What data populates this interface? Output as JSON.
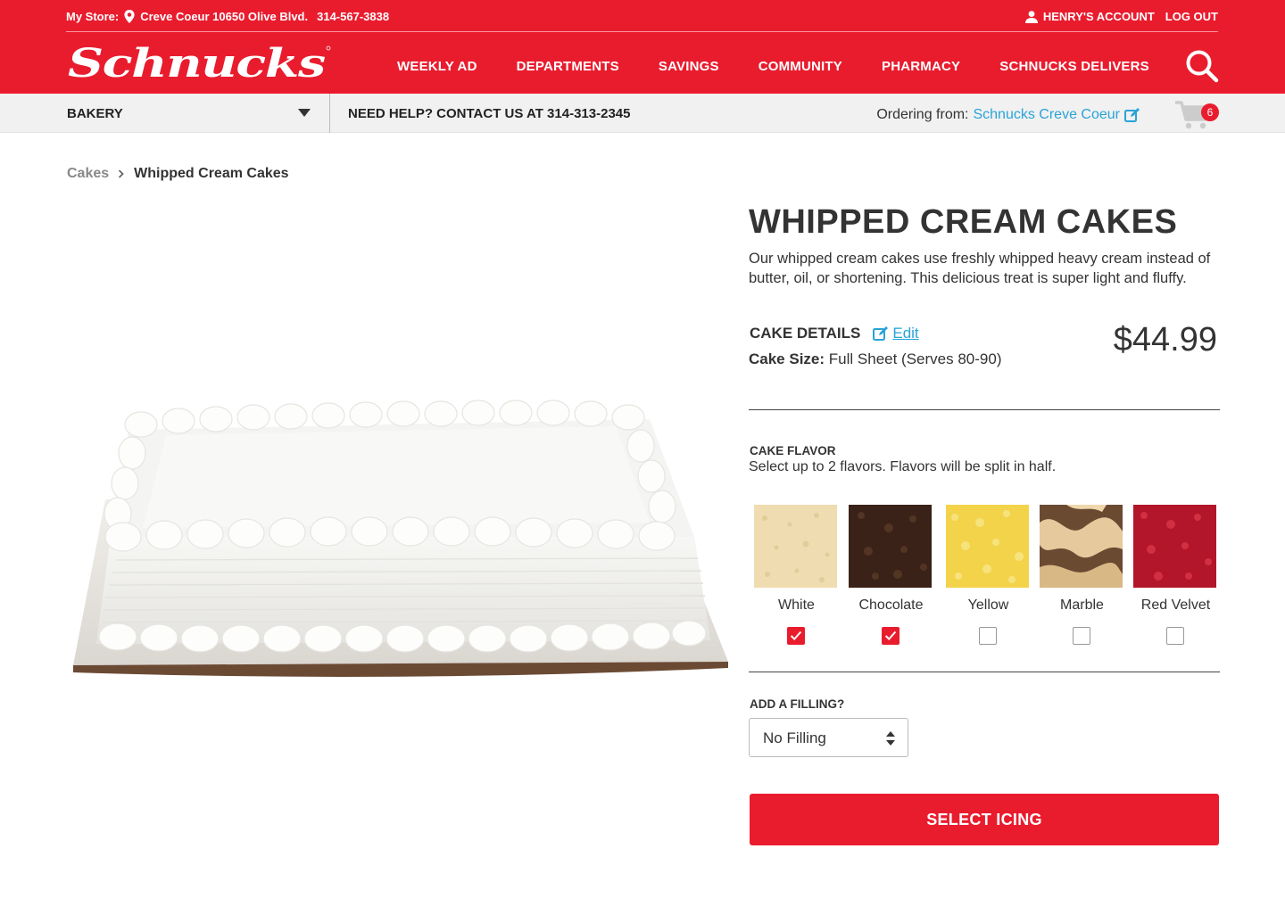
{
  "header": {
    "store_label": "My Store:",
    "store_location": "Creve Coeur 10650 Olive Blvd.",
    "store_phone": "314-567-3838",
    "account_label": "HENRY'S ACCOUNT",
    "logout_label": "LOG OUT",
    "logo_text": "Schnucks",
    "nav": [
      "WEEKLY AD",
      "DEPARTMENTS",
      "SAVINGS",
      "COMMUNITY",
      "PHARMACY",
      "SCHNUCKS DELIVERS"
    ]
  },
  "subbar": {
    "department": "BAKERY",
    "help_text": "NEED HELP? CONTACT US AT 314-313-2345",
    "ordering_label": "Ordering from:",
    "ordering_store": "Schnucks Creve Coeur",
    "cart_count": "6"
  },
  "breadcrumb": {
    "parent": "Cakes",
    "current": "Whipped Cream Cakes"
  },
  "product": {
    "title": "WHIPPED CREAM CAKES",
    "description": "Our whipped cream cakes use freshly whipped heavy cream instead of butter, oil, or shortening. This delicious treat is super light and fluffy.",
    "details_label": "CAKE DETAILS",
    "edit_label": "Edit",
    "size_label": "Cake Size:",
    "size_value": "Full Sheet (Serves 80-90)",
    "price": "$44.99"
  },
  "flavor_section": {
    "heading": "CAKE FLAVOR",
    "instructions": "Select up to 2 flavors. Flavors will be split in half.",
    "flavors": [
      {
        "name": "White",
        "checked": true,
        "color": "#efdcb0"
      },
      {
        "name": "Chocolate",
        "checked": true,
        "color": "#3a2218"
      },
      {
        "name": "Yellow",
        "checked": false,
        "color": "#f3d34a"
      },
      {
        "name": "Marble",
        "checked": false,
        "color": "#6b4a32"
      },
      {
        "name": "Red Velvet",
        "checked": false,
        "color": "#b3162a"
      }
    ]
  },
  "filling": {
    "heading": "ADD A FILLING?",
    "selected": "No Filling"
  },
  "cta_label": "SELECT ICING",
  "colors": {
    "brand_red": "#e91c2e",
    "link_blue": "#29a3d8"
  }
}
